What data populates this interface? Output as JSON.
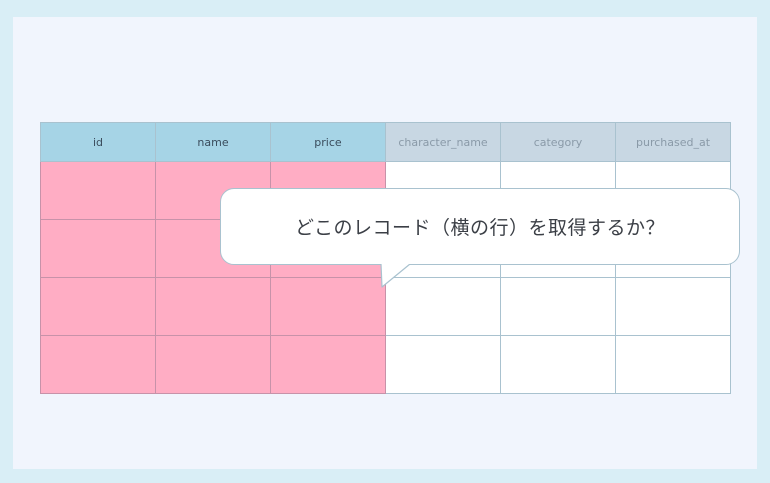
{
  "table": {
    "columns": [
      {
        "label": "id",
        "selected": true
      },
      {
        "label": "name",
        "selected": true
      },
      {
        "label": "price",
        "selected": true
      },
      {
        "label": "character_name",
        "selected": false
      },
      {
        "label": "category",
        "selected": false
      },
      {
        "label": "purchased_at",
        "selected": false
      }
    ],
    "row_count": 4
  },
  "bubble": {
    "text": "どこのレコード（横の行）を取得するか？"
  },
  "colors": {
    "background": "#d9eef6",
    "card": "#f1f5fd",
    "selected_header": "#a6d4e6",
    "unselected_header": "#c8d7e3",
    "selected_cell": "#ffadc4",
    "unselected_cell": "#ffffff",
    "grid_line": "#a9c2cf"
  }
}
